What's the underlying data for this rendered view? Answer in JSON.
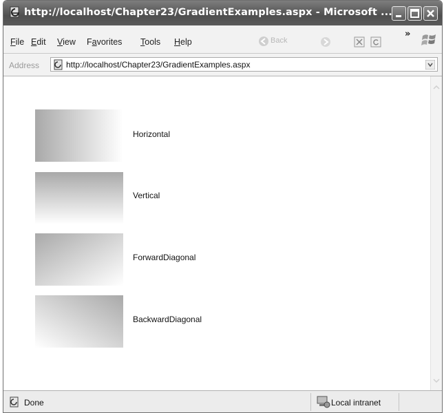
{
  "window": {
    "title": "http://localhost/Chapter23/GradientExamples.aspx - Microsoft ...",
    "controls": [
      "minimize-icon",
      "maximize-icon",
      "close-icon"
    ]
  },
  "menu": {
    "items": [
      {
        "key": "F",
        "rest": "ile"
      },
      {
        "key": "E",
        "rest": "dit"
      },
      {
        "key": "V",
        "rest": "iew"
      },
      {
        "pre": "F",
        "key": "a",
        "rest": "vorites"
      },
      {
        "key": "T",
        "rest": "ools"
      },
      {
        "key": "H",
        "rest": "elp"
      }
    ],
    "back_label": "Back",
    "chevron": "»"
  },
  "address": {
    "label": "Address",
    "url": "http://localhost/Chapter23/GradientExamples.aspx"
  },
  "gradients": [
    {
      "label": "Horizontal",
      "mode": "horizontal"
    },
    {
      "label": "Vertical",
      "mode": "vertical"
    },
    {
      "label": "ForwardDiagonal",
      "mode": "forward-diagonal"
    },
    {
      "label": "BackwardDiagonal",
      "mode": "backward-diagonal"
    }
  ],
  "status": {
    "text": "Done",
    "zone": "Local intranet"
  },
  "colors": {
    "titlebar": "#5a5a5a",
    "gradient_start": "#a9a9a9",
    "gradient_end": "#ffffff"
  }
}
